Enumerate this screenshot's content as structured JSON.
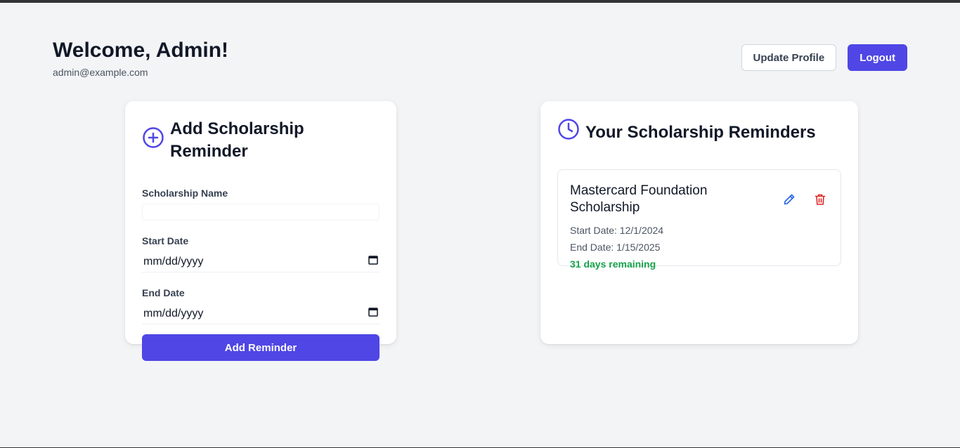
{
  "header": {
    "greeting": "Welcome, Admin!",
    "email": "admin@example.com",
    "update_profile_label": "Update Profile",
    "logout_label": "Logout"
  },
  "add_form": {
    "title": "Add Scholarship Reminder",
    "title_icon": "plus-circle-icon",
    "name_label": "Scholarship Name",
    "name_value": "",
    "start_label": "Start Date",
    "start_placeholder": "mm/dd/yyyy",
    "end_label": "End Date",
    "end_placeholder": "mm/dd/yyyy",
    "submit_label": "Add Reminder"
  },
  "reminders": {
    "title": "Your Scholarship Reminders",
    "title_icon": "clock-icon",
    "items": [
      {
        "name": "Mastercard Foundation Scholarship",
        "start": "Start Date: 12/1/2024",
        "end": "End Date: 1/15/2025",
        "remaining": "31 days remaining",
        "edit_icon": "pencil-icon",
        "delete_icon": "trash-icon"
      }
    ]
  },
  "colors": {
    "accent": "#4f46e5",
    "danger": "#dc2626",
    "success": "#16a34a",
    "edit": "#2563eb"
  }
}
